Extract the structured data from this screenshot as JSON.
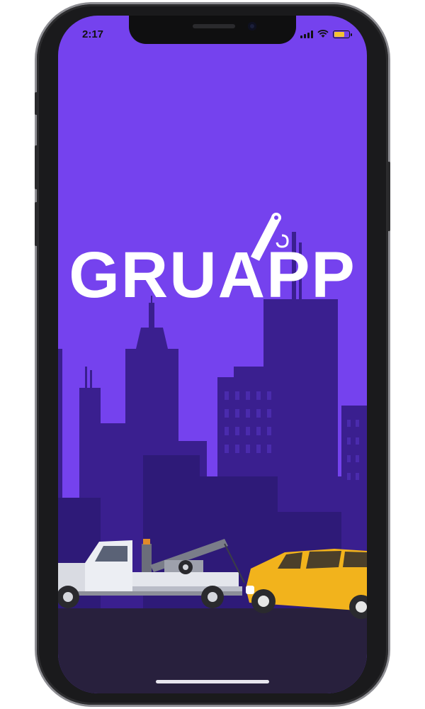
{
  "status_bar": {
    "time": "2:17",
    "signal_icon": "cellular-signal-icon",
    "wifi_icon": "wifi-icon",
    "battery_icon": "battery-icon",
    "battery_color": "#f4c430"
  },
  "splash": {
    "logo_text": "GRUAPP",
    "logo_icon": "tow-hook-icon",
    "background_color": "#7542ee",
    "skyline_color": "#3a1f8f",
    "ground_color": "#28203d",
    "car_color": "#f2b31c"
  }
}
